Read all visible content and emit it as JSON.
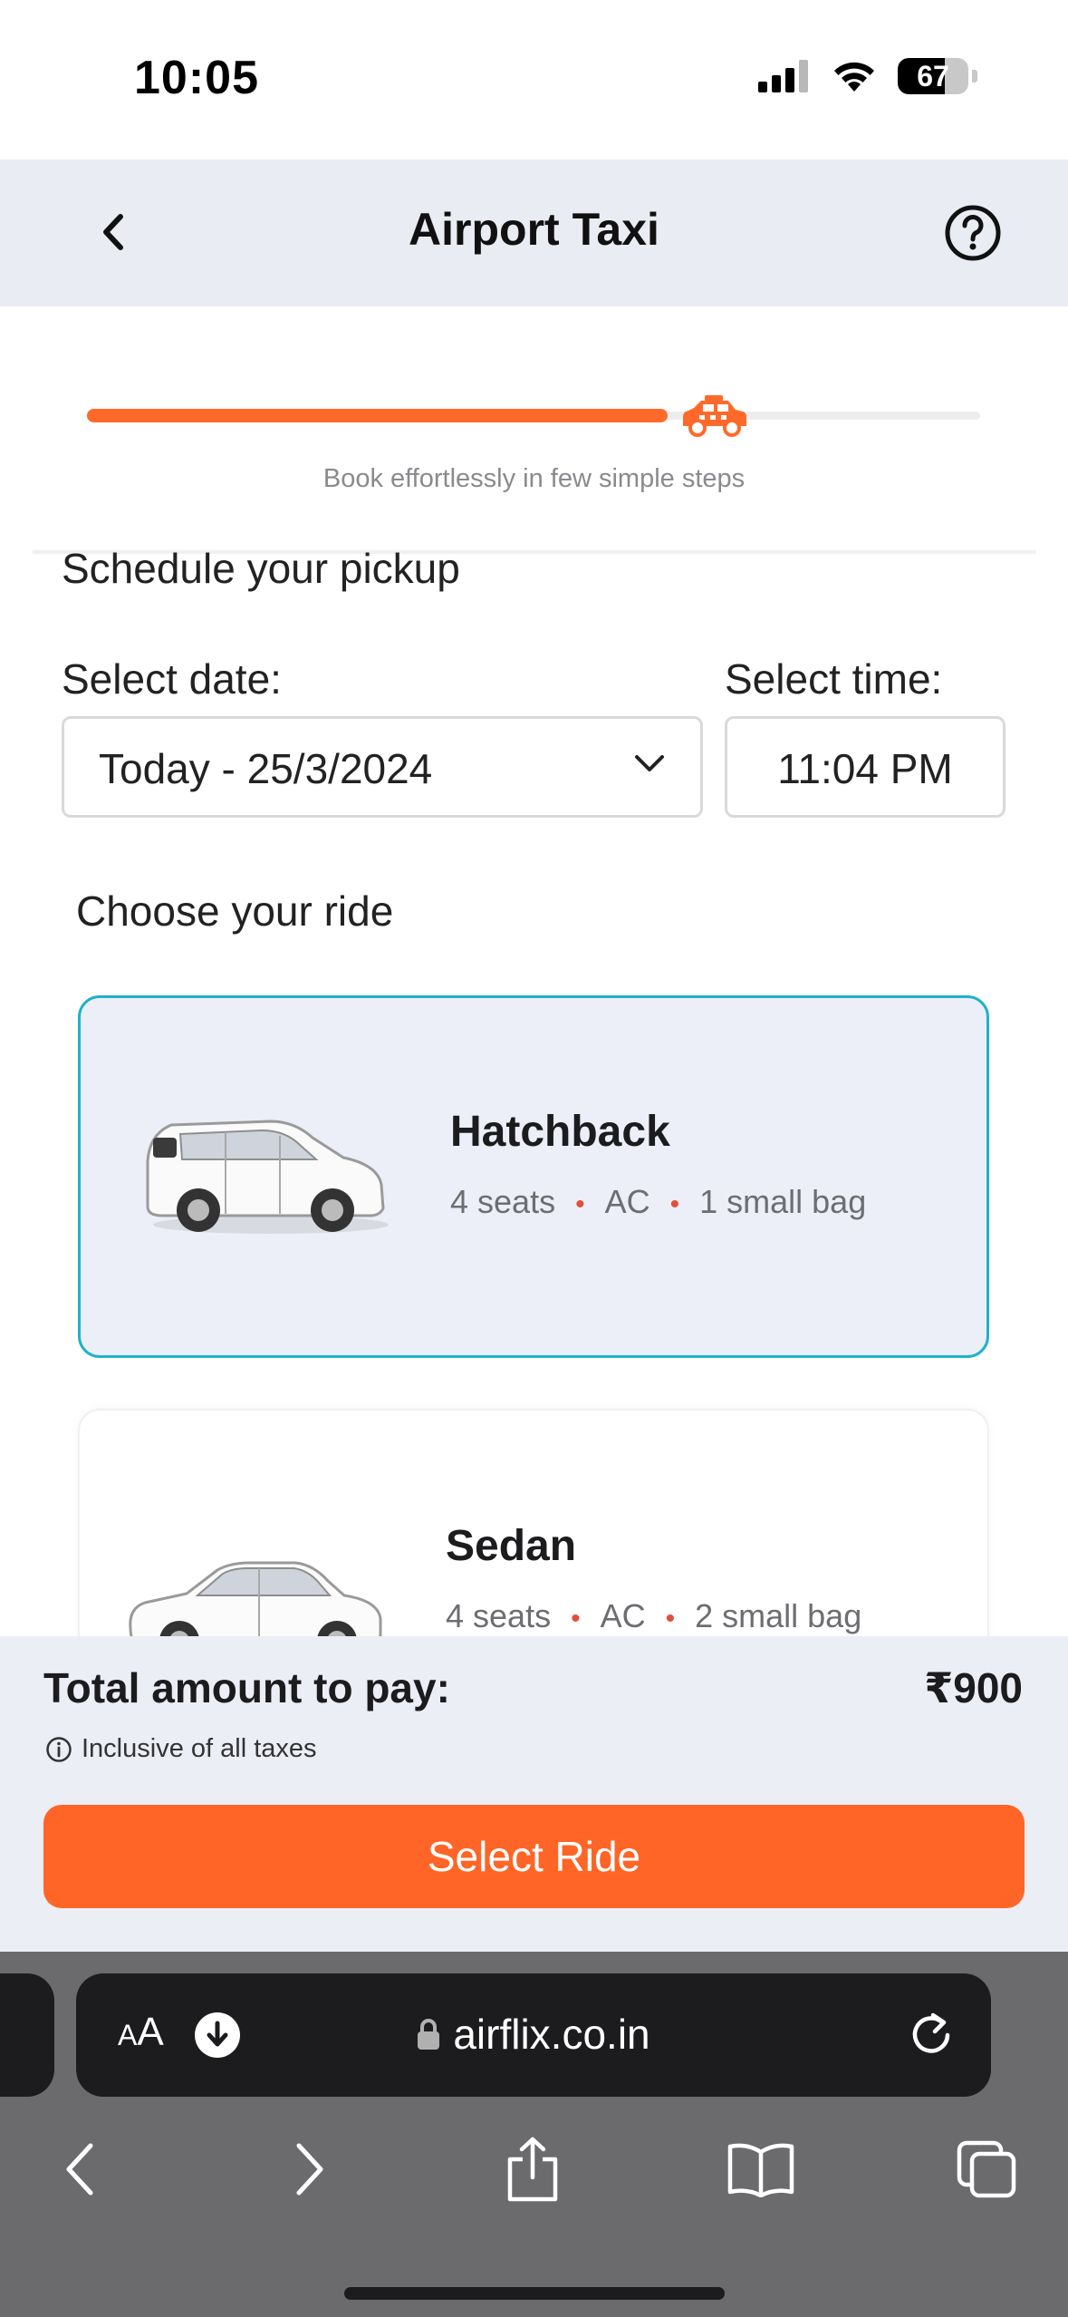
{
  "status_bar": {
    "time": "10:05",
    "battery": "67",
    "battery_level": 0.67
  },
  "header": {
    "title": "Airport Taxi"
  },
  "progress": {
    "caption": "Book effortlessly in few simple steps",
    "fraction": 0.65
  },
  "schedule": {
    "title": "Schedule your pickup",
    "date_label": "Select date:",
    "date_value": "Today - 25/3/2024",
    "time_label": "Select time:",
    "time_value": "11:04 PM"
  },
  "rides": {
    "title": "Choose your ride",
    "items": [
      {
        "name": "Hatchback",
        "seats": "4 seats",
        "ac": "AC",
        "bags": "1 small bag",
        "selected": true
      },
      {
        "name": "Sedan",
        "seats": "4 seats",
        "ac": "AC",
        "bags": "2 small bag",
        "selected": false
      }
    ]
  },
  "summary": {
    "total_label": "Total amount to pay:",
    "total_amount": "₹900",
    "tax_note": "Inclusive of all taxes",
    "button_label": "Select Ride"
  },
  "browser": {
    "aa_small": "A",
    "aa_large": "A",
    "url": "airflix.co.in"
  },
  "colors": {
    "accent": "#ff6526",
    "selected_border": "#1fb2c8",
    "header_bg": "#eaecf4"
  }
}
